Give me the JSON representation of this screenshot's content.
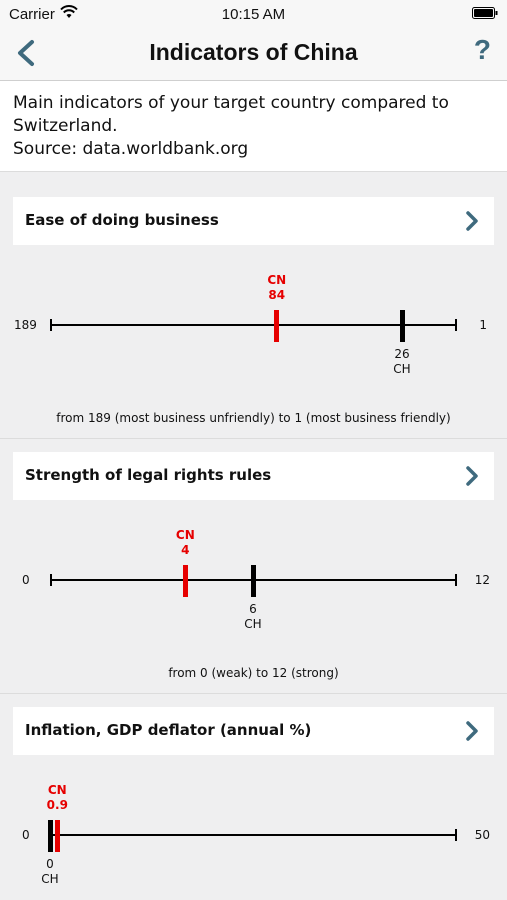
{
  "status_bar": {
    "carrier": "Carrier",
    "time": "10:15 AM"
  },
  "nav": {
    "title": "Indicators of China",
    "help": "?"
  },
  "intro": {
    "text": "Main indicators of your target country compared to Switzerland.\nSource: data.worldbank.org"
  },
  "indicators": [
    {
      "title": "Ease of doing business",
      "scale_left": "189",
      "scale_right": "1",
      "min": 189,
      "max": 1,
      "cn": {
        "code": "CN",
        "value": 84
      },
      "ch": {
        "code": "CH",
        "value": 26
      },
      "caption": "from 189 (most business unfriendly) to 1 (most business friendly)"
    },
    {
      "title": "Strength of legal rights rules",
      "scale_left": "0",
      "scale_right": "12",
      "min": 0,
      "max": 12,
      "cn": {
        "code": "CN",
        "value": 4
      },
      "ch": {
        "code": "CH",
        "value": 6
      },
      "caption": "from 0 (weak) to 12 (strong)"
    },
    {
      "title": "Inflation, GDP deflator (annual %)",
      "scale_left": "0",
      "scale_right": "50",
      "min": 0,
      "max": 50,
      "cn": {
        "code": "CN",
        "value": 0.9
      },
      "ch": {
        "code": "CH",
        "value": 0
      },
      "caption": ""
    }
  ],
  "colors": {
    "cn": "#e60000",
    "ch": "#000000",
    "accent": "#3f6a7e"
  },
  "icons": {
    "back": "chevron-left-icon",
    "help": "help-icon",
    "disclosure": "chevron-right-icon"
  }
}
